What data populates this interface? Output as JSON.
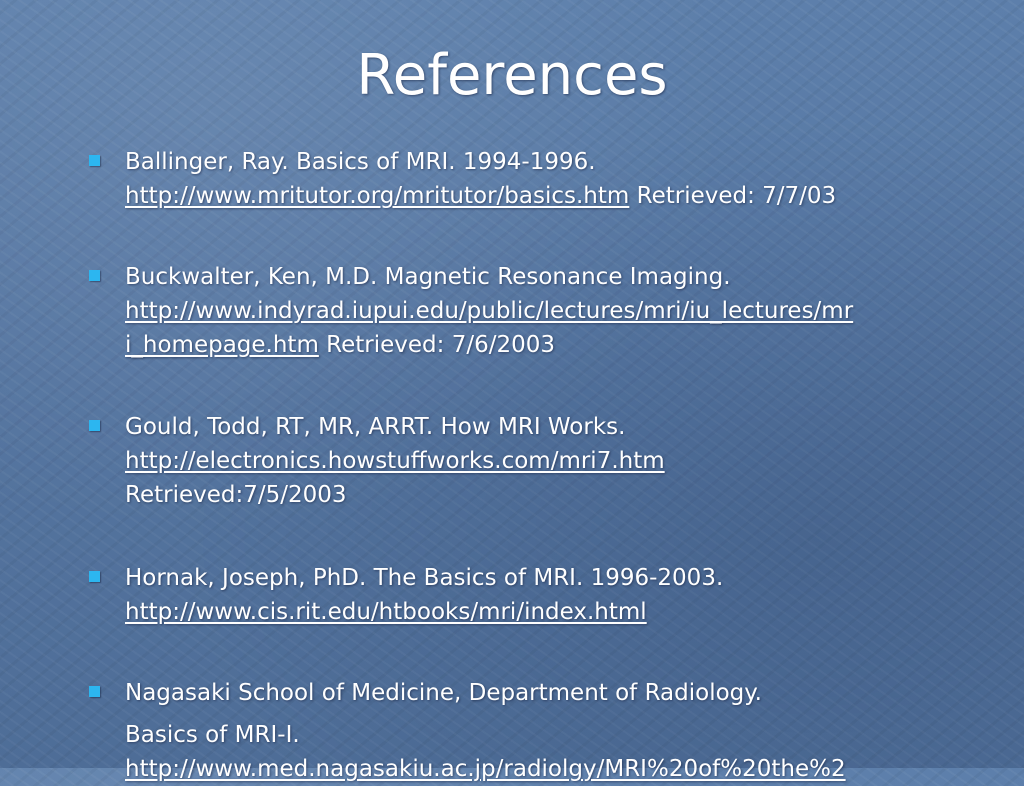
{
  "title": "References",
  "references": [
    {
      "text": "Ballinger, Ray. Basics of MRI. 1994-1996.",
      "url": "http://www.mritutor.org/mritutor/basics.htm",
      "retrieved": "Retrieved: 7/7/03"
    },
    {
      "text": "Buckwalter, Ken, M.D. Magnetic Resonance Imaging.",
      "url_line1": "http://www.indyrad.iupui.edu/public/lectures/mri/iu_lectures/mr",
      "url_line2": "i_homepage.htm",
      "retrieved": "Retrieved: 7/6/2003"
    },
    {
      "text": "Gould, Todd, RT, MR, ARRT. How MRI Works.",
      "url": "http://electronics.howstuffworks.com/mri7.htm",
      "retrieved": "Retrieved:7/5/2003"
    },
    {
      "text": "Hornak, Joseph, PhD. The Basics of MRI. 1996-2003.",
      "url": "http://www.cis.rit.edu/htbooks/mri/index.html"
    },
    {
      "text": "Nagasaki School of Medicine, Department of Radiology.",
      "text2": "Basics of MRI-I.",
      "url": "http://www.med.nagasakiu.ac.jp/radiolgy/MRI%20of%20the%2"
    }
  ],
  "colors": {
    "background": "#5879a5",
    "bullet": "#2cb6f0",
    "text": "#ffffff"
  }
}
